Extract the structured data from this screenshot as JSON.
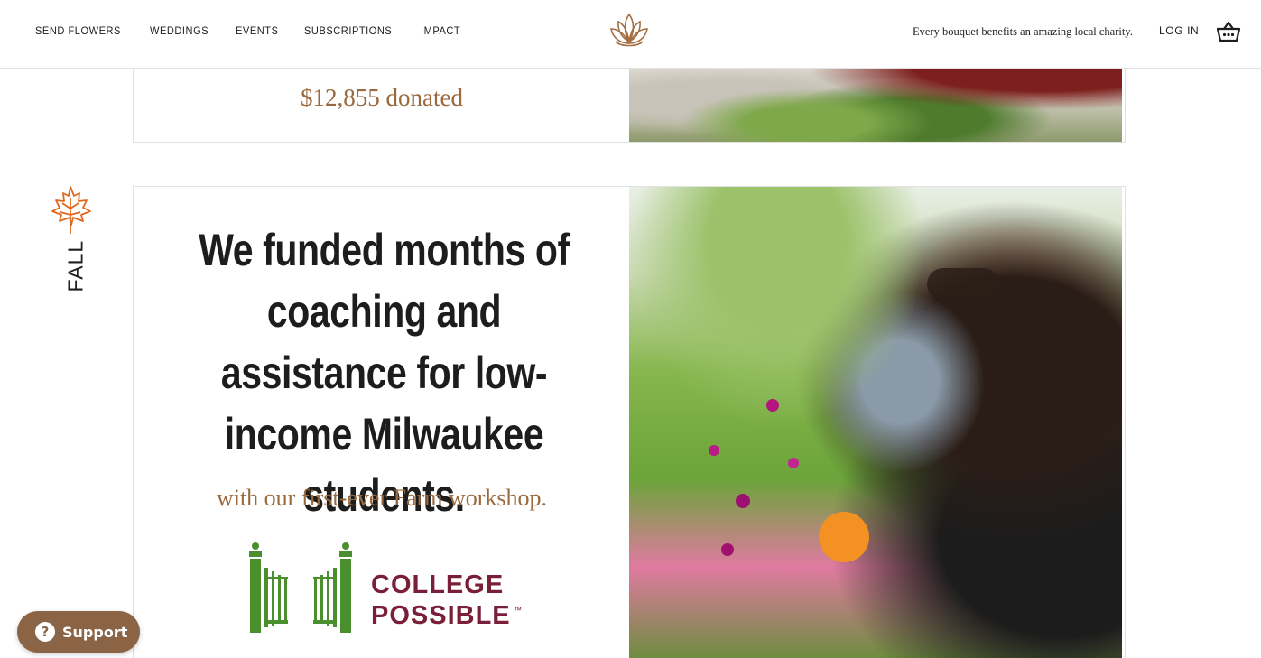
{
  "header": {
    "nav": [
      "SEND FLOWERS",
      "WEDDINGS",
      "EVENTS",
      "SUBSCRIPTIONS",
      "IMPACT"
    ],
    "tagline": "Every bouquet benefits an amazing local charity.",
    "login_label": "LOG IN",
    "logo_icon": "lotus-logo-icon",
    "cart_icon": "basket-icon"
  },
  "previous_card": {
    "amount": "$12,855 donated"
  },
  "season": {
    "label": "FALL",
    "icon": "maple-leaf-icon",
    "icon_color": "#e0681c"
  },
  "impact_card": {
    "headline": "We funded months of coaching and assistance for low-income Milwaukee students.",
    "subline": "with our first-ever Farm workshop.",
    "partner": {
      "line1": "COLLEGE",
      "line2": "POSSIBLE",
      "trademark": "™",
      "gate_color": "#4a8f2e",
      "text_color": "#7a1f3a"
    }
  },
  "support_button": {
    "label": "Support",
    "icon": "question-icon"
  },
  "colors": {
    "accent_brown": "#9a6a3e",
    "support_bg": "#8b6446"
  }
}
